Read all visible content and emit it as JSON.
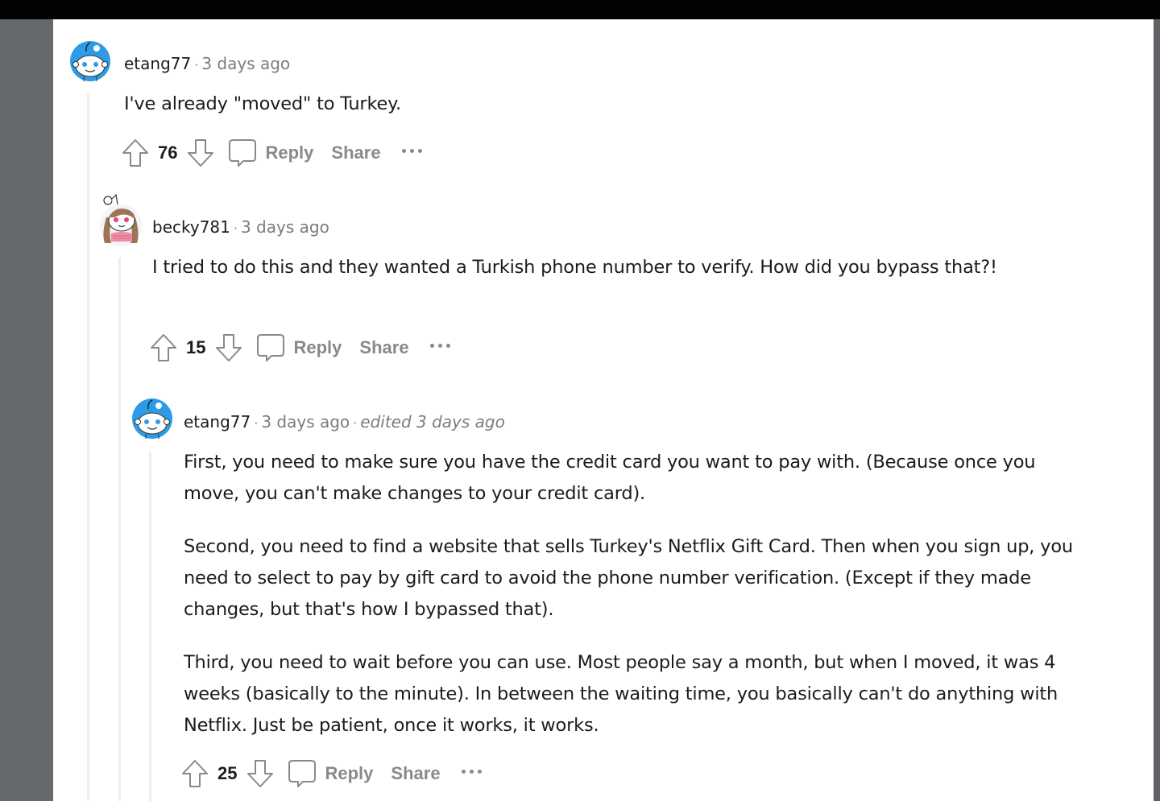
{
  "colors": {
    "avatar_blue": "#2d9be5",
    "text_primary": "#1c1c1c",
    "text_meta": "#7c7c7c",
    "action_gray": "#878a8c",
    "thread_line": "#ededf0",
    "pink_accent": "#e8407a"
  },
  "comments": [
    {
      "username": "etang77",
      "separator": "·",
      "time": "3 days ago",
      "avatar_icon": "snoo-avatar-blue",
      "body": [
        "I've already \"moved\" to Turkey."
      ],
      "score": "76",
      "actions": {
        "reply": "Reply",
        "share": "Share",
        "more": "more-options-icon"
      }
    },
    {
      "username": "becky781",
      "separator": "·",
      "time": "3 days ago",
      "avatar_icon": "snoo-avatar-girl",
      "body": [
        "I tried to do this and they wanted a Turkish phone number to verify. How did you bypass that?!"
      ],
      "score": "15",
      "actions": {
        "reply": "Reply",
        "share": "Share",
        "more": "more-options-icon"
      }
    },
    {
      "username": "etang77",
      "separator": "·",
      "time": "3 days ago",
      "edited_separator": "·",
      "edited": "edited 3 days ago",
      "avatar_icon": "snoo-avatar-blue",
      "body": [
        "First, you need to make sure you have the credit card you want to pay with. (Because once you move, you can't make changes to your credit card).",
        "Second, you need to find a website that sells Turkey's Netflix Gift Card. Then when you sign up, you need to select to pay by gift card to avoid the phone number verification. (Except if they made changes, but that's how I bypassed that).",
        "Third, you need to wait before you can use. Most people say a month, but when I moved, it was 4 weeks (basically to the minute). In between the waiting time, you basically can't do anything with Netflix. Just be patient, once it works, it works."
      ],
      "score": "25",
      "actions": {
        "reply": "Reply",
        "share": "Share",
        "more": "more-options-icon"
      }
    }
  ]
}
